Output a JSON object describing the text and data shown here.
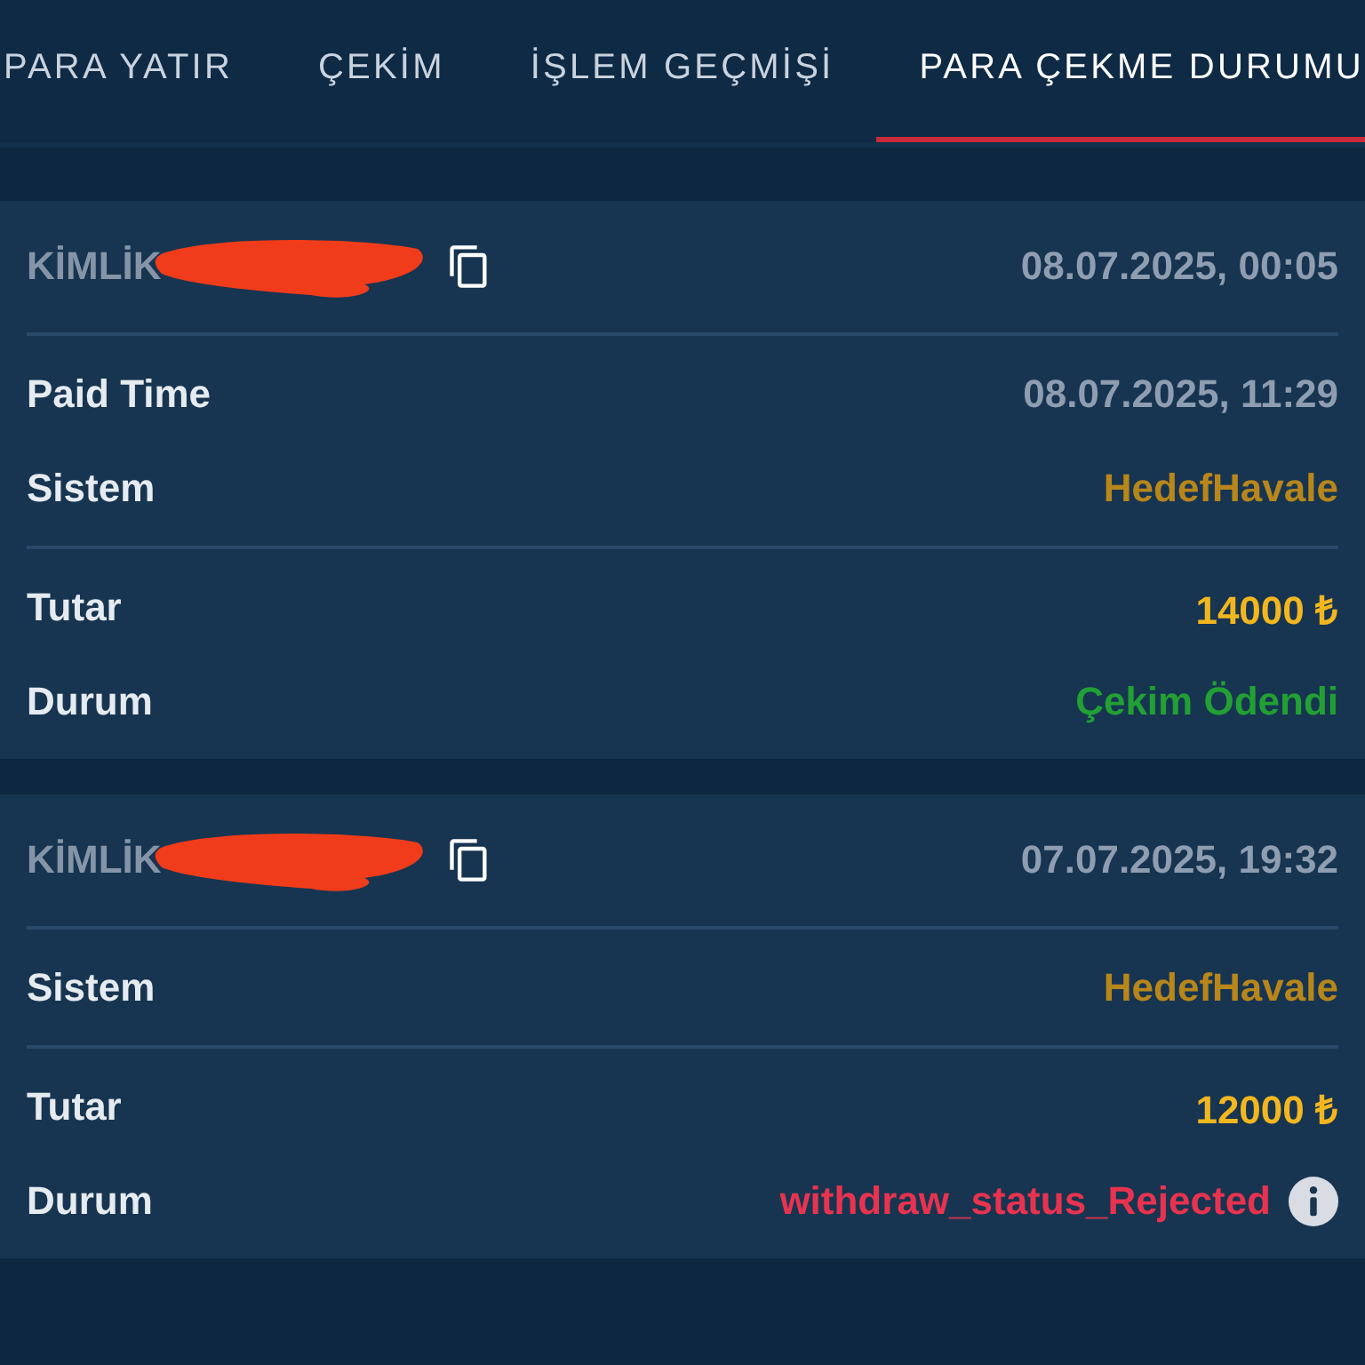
{
  "tabs": [
    {
      "label": "PARA YATIR",
      "selected": false
    },
    {
      "label": "ÇEKİM",
      "selected": false
    },
    {
      "label": "İŞLEM GEÇMİŞİ",
      "selected": false
    },
    {
      "label": "PARA ÇEKME DURUMU",
      "selected": true
    }
  ],
  "cards": [
    {
      "id_label": "KİMLİK",
      "date": "08.07.2025, 00:05",
      "sections": [
        [
          {
            "label": "Paid Time",
            "value": "08.07.2025, 11:29",
            "kind": "time"
          },
          {
            "label": "Sistem",
            "value": "HedefHavale",
            "kind": "system"
          }
        ],
        [
          {
            "label": "Tutar",
            "value": "14000 ₺",
            "kind": "amount"
          },
          {
            "label": "Durum",
            "value": "Çekim Ödendi",
            "kind": "paid"
          }
        ]
      ]
    },
    {
      "id_label": "KİMLİK",
      "date": "07.07.2025, 19:32",
      "sections": [
        [
          {
            "label": "Sistem",
            "value": "HedefHavale",
            "kind": "system"
          }
        ],
        [
          {
            "label": "Tutar",
            "value": "12000 ₺",
            "kind": "amount"
          },
          {
            "label": "Durum",
            "value": "withdraw_status_Rejected",
            "kind": "rejected",
            "info": true
          }
        ]
      ]
    }
  ]
}
